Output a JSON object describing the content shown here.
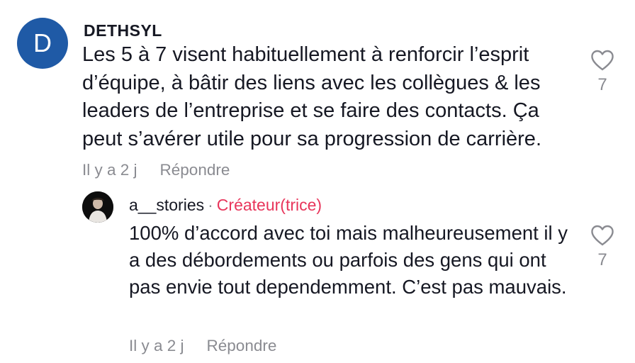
{
  "comment": {
    "avatar_letter": "D",
    "username": "DETHSYL",
    "text": "Les 5 à 7 visent habituellement à renforcir l’esprit d’équipe, à bâtir des liens avec les collègues & les leaders de l’entreprise et se faire des contacts. Ça peut s’avérer utile pour sa progression de carrière.",
    "time": "Il y a 2 j",
    "reply_label": "Répondre",
    "like_count": "7",
    "like_icon": "heart-outline-icon"
  },
  "reply": {
    "username": "a__stories",
    "separator": "·",
    "badge": "Créateur(trice)",
    "text": "100% d’accord avec toi mais malheureusement il y a des débordements ou parfois des gens qui ont pas envie tout dependemment. C’est pas mauvais.",
    "time": "Il y a 2 j",
    "reply_label": "Répondre",
    "like_count": "7",
    "like_icon": "heart-outline-icon"
  },
  "colors": {
    "avatar_bg": "#1f5aa6",
    "creator_badge": "#e8355b",
    "muted_text": "#8a8b91",
    "primary_text": "#161823"
  }
}
